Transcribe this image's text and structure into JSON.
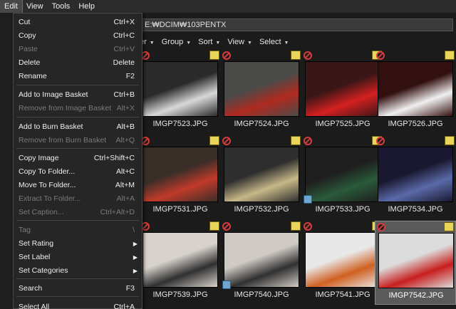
{
  "menubar": {
    "items": [
      {
        "label": "Edit",
        "active": true
      },
      {
        "label": "View",
        "active": false
      },
      {
        "label": "Tools",
        "active": false
      },
      {
        "label": "Help",
        "active": false
      }
    ]
  },
  "pathbar": {
    "path": "E:₩DCIM₩103PENTX"
  },
  "toolbar": {
    "partial_label": "er",
    "group_label": "Group",
    "sort_label": "Sort",
    "view_label": "View",
    "select_label": "Select"
  },
  "edit_menu": {
    "items": [
      {
        "label": "Cut",
        "shortcut": "Ctrl+X",
        "disabled": false
      },
      {
        "label": "Copy",
        "shortcut": "Ctrl+C",
        "disabled": false
      },
      {
        "label": "Paste",
        "shortcut": "Ctrl+V",
        "disabled": true
      },
      {
        "label": "Delete",
        "shortcut": "Delete",
        "disabled": false
      },
      {
        "label": "Rename",
        "shortcut": "F2",
        "disabled": false
      },
      {
        "label": "Add to Image Basket",
        "shortcut": "Ctrl+B",
        "disabled": false
      },
      {
        "label": "Remove from Image Basket",
        "shortcut": "Alt+X",
        "disabled": true
      },
      {
        "label": "Add to Burn Basket",
        "shortcut": "Alt+B",
        "disabled": false
      },
      {
        "label": "Remove from Burn Basket",
        "shortcut": "Alt+Q",
        "disabled": true
      },
      {
        "label": "Copy Image",
        "shortcut": "Ctrl+Shift+C",
        "disabled": false
      },
      {
        "label": "Copy To Folder...",
        "shortcut": "Alt+C",
        "disabled": false
      },
      {
        "label": "Move To Folder...",
        "shortcut": "Alt+M",
        "disabled": false
      },
      {
        "label": "Extract To Folder...",
        "shortcut": "Alt+A",
        "disabled": true
      },
      {
        "label": "Set Caption...",
        "shortcut": "Ctrl+Alt+D",
        "disabled": true
      },
      {
        "label": "Tag",
        "shortcut": "\\",
        "disabled": true
      },
      {
        "label": "Set Rating",
        "shortcut": "",
        "disabled": false,
        "submenu": true
      },
      {
        "label": "Set Label",
        "shortcut": "",
        "disabled": false,
        "submenu": true
      },
      {
        "label": "Set Categories",
        "shortcut": "",
        "disabled": false,
        "submenu": true
      },
      {
        "label": "Search",
        "shortcut": "F3",
        "disabled": false
      },
      {
        "label": "Select All",
        "shortcut": "Ctrl+A",
        "disabled": false
      }
    ]
  },
  "thumbnails": [
    {
      "name": "IMGP7523.JPG",
      "selected": false,
      "bg": "#2a2a2a",
      "accent": "#d8d8d8"
    },
    {
      "name": "IMGP7524.JPG",
      "selected": false,
      "bg": "#4a4a48",
      "accent": "#b02a20"
    },
    {
      "name": "IMGP7525.JPG",
      "selected": false,
      "bg": "#3a1616",
      "accent": "#d42020"
    },
    {
      "name": "IMGP7526.JPG",
      "selected": false,
      "bg": "#331010",
      "accent": "#f0f0f0"
    },
    {
      "name": "IMGP7531.JPG",
      "selected": false,
      "bg": "#3a2e28",
      "accent": "#c03a2a"
    },
    {
      "name": "IMGP7532.JPG",
      "selected": false,
      "bg": "#2e2e2e",
      "accent": "#c8b888"
    },
    {
      "name": "IMGP7533.JPG",
      "selected": false,
      "bg": "#1e1e1e",
      "accent": "#2a5a3a"
    },
    {
      "name": "IMGP7534.JPG",
      "selected": false,
      "bg": "#1a1830",
      "accent": "#5a6aa8"
    },
    {
      "name": "IMGP7539.JPG",
      "selected": false,
      "bg": "#d8d2cc",
      "accent": "#303030"
    },
    {
      "name": "IMGP7540.JPG",
      "selected": false,
      "bg": "#d0cac4",
      "accent": "#303030"
    },
    {
      "name": "IMGP7541.JPG",
      "selected": false,
      "bg": "#e8e8e8",
      "accent": "#d06020"
    },
    {
      "name": "IMGP7542.JPG",
      "selected": true,
      "bg": "#dcdcdc",
      "accent": "#c81e1e"
    }
  ],
  "colors": {
    "menu_bg": "#262626",
    "disabled_text": "#7a7a7a",
    "no_sign": "#d43b3b",
    "raw_tag": "#e8d55a"
  }
}
